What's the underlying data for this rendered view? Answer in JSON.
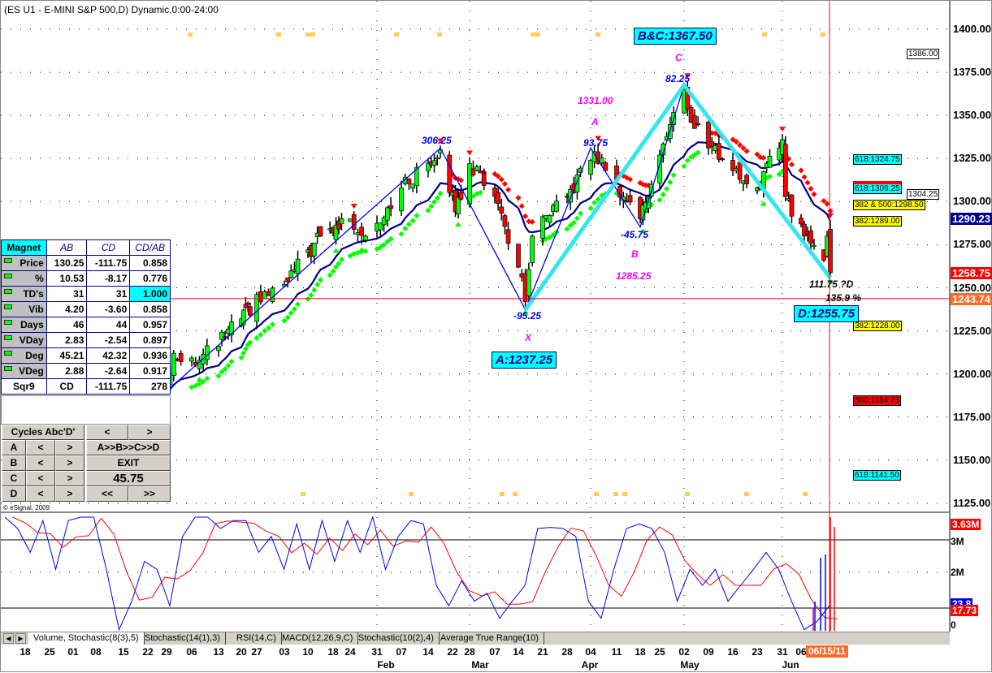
{
  "window": {
    "title": "(ES U1 - E-MINI S&P 500,D) Dynamic,0:00-24:00",
    "copyright": "© eSignal, 2009"
  },
  "colors": {
    "cyan": "#00ffff",
    "navy": "#00008b",
    "magenta": "#ff00ff",
    "red": "#ff0000",
    "green": "#00cc00",
    "orange": "#ff6a2a",
    "yellow": "#ffff00"
  },
  "price_axis": {
    "labels": [
      "1400.00",
      "1375.00",
      "1350.00",
      "1325.00",
      "1300.00",
      "1275.00",
      "1250.00",
      "1225.00",
      "1200.00",
      "1175.00",
      "1150.00",
      "1125.00"
    ],
    "highlights": [
      {
        "value": "1290.23",
        "price": 1290.23,
        "color": "#00008b"
      },
      {
        "value": "1258.75",
        "price": 1258.75,
        "color": "#ff0000"
      },
      {
        "value": "1243.74",
        "price": 1243.74,
        "color": "#ff6a2a"
      }
    ],
    "boxes": [
      {
        "text": "1386.00",
        "price": 1386
      },
      {
        "text": "1304.25",
        "price": 1304.25
      }
    ]
  },
  "fib_levels": [
    {
      "text": "618:1324.75",
      "price": 1324.75,
      "color": "#00ffff"
    },
    {
      "text": "618:1309.25",
      "price": 1309.25,
      "color": "#00ffff"
    },
    {
      "text": "382 & 500:1298.50",
      "price": 1298.5,
      "color": "#ffff00"
    },
    {
      "text": "382:1289.00",
      "price": 1289,
      "color": "#ffff00"
    },
    {
      "text": "382:1228.00",
      "price": 1228,
      "color": "#ffff00"
    },
    {
      "text": "500:1184.75",
      "price": 1184.75,
      "color": "#ff0000"
    },
    {
      "text": "618:1141.50",
      "price": 1141.5,
      "color": "#00ffff"
    }
  ],
  "pattern": {
    "boxes": {
      "bc": "B&C:1367.50",
      "a": "A:1237.25",
      "d": "D:1255.75"
    },
    "labels": {
      "p1": "306.25",
      "x_val": "-95.25",
      "a_val": "93.75",
      "b_val": "-45.75",
      "c_val": "82.25",
      "d_val": "111.75 ?D",
      "d_pct": "135.9 %",
      "a_price": "1331.00",
      "a_letter": "A",
      "b_price": "1285.25",
      "b_letter": "B",
      "c_letter": "C",
      "x_letter": "X"
    },
    "blue_points": [
      [
        "2010-11-29",
        1190
      ],
      [
        "2011-02-18",
        1331
      ],
      [
        "2011-03-16",
        1237.25
      ],
      [
        "2011-04-04",
        1331
      ],
      [
        "2011-04-18",
        1285.25
      ],
      [
        "2011-05-02",
        1367.5
      ]
    ],
    "cyan_points": [
      [
        "2011-03-16",
        1237.25
      ],
      [
        "2011-05-02",
        1367.5
      ],
      [
        "2011-06-15",
        1255.75
      ]
    ]
  },
  "magnet": {
    "headers": [
      "Magnet",
      "AB",
      "CD",
      "CD/AB"
    ],
    "rows": [
      [
        "Price",
        "130.25",
        "-111.75",
        "0.858"
      ],
      [
        "%",
        "10.53",
        "-8.17",
        "0.776"
      ],
      [
        "TD's",
        "31",
        "31",
        "1.000"
      ],
      [
        "Vib",
        "4.20",
        "-3.60",
        "0.858"
      ],
      [
        "Days",
        "46",
        "44",
        "0.957"
      ],
      [
        "VDay",
        "2.83",
        "-2.54",
        "0.897"
      ],
      [
        "Deg",
        "45.21",
        "42.32",
        "0.936"
      ],
      [
        "VDeg",
        "2.88",
        "-2.64",
        "0.917"
      ]
    ],
    "sqr9": [
      "Sqr9",
      "CD",
      "-111.75",
      "278"
    ]
  },
  "cycles": {
    "title": "Cycles Abc'D'",
    "left": "<",
    "right": ">",
    "rows": [
      "A",
      "B",
      "C",
      "D"
    ],
    "sequence": "A>>B>>C>>D",
    "exit": "EXIT",
    "value": "45.75",
    "prev": "<<",
    "next": ">>"
  },
  "lower_axis": {
    "labels": [
      "3M",
      "2M",
      "0"
    ],
    "vol_last": "3.63M",
    "stoch_blue": "23.8",
    "stoch_red": "17.73"
  },
  "tabs": [
    "Volume, Stochastic(8(3),5)",
    "Stochastic(14(1),3)",
    "RSI(14,C)",
    "MACD(12,26,9,C)",
    "Stochastic(10(2),4)",
    "Average True Range(10)"
  ],
  "date_axis": {
    "days": [
      "18",
      "25",
      "01",
      "08",
      "15",
      "22",
      "29",
      "06",
      "13",
      "20",
      "27",
      "03",
      "10",
      "18",
      "24",
      "31",
      "07",
      "14",
      "22",
      "28",
      "07",
      "14",
      "21",
      "28",
      "04",
      "11",
      "18",
      "25",
      "02",
      "09",
      "16",
      "23",
      "31",
      "06"
    ],
    "months": [
      "Feb",
      "Mar",
      "Apr",
      "May",
      "Jun"
    ],
    "current": "06/15/11"
  },
  "chart_data": {
    "type": "candlestick",
    "title": "(ES U1 - E-MINI S&P 500,D)",
    "ylim": [
      1125,
      1400
    ],
    "price_path": [
      [
        "2010-11-29",
        1190
      ],
      [
        "2010-12-01",
        1212
      ],
      [
        "2010-12-08",
        1208
      ],
      [
        "2010-12-20",
        1232
      ],
      [
        "2011-01-03",
        1252
      ],
      [
        "2011-01-14",
        1280
      ],
      [
        "2011-01-24",
        1290
      ],
      [
        "2011-01-28",
        1280
      ],
      [
        "2011-02-07",
        1308
      ],
      [
        "2011-02-18",
        1330
      ],
      [
        "2011-02-23",
        1294
      ],
      [
        "2011-02-28",
        1322
      ],
      [
        "2011-03-07",
        1303
      ],
      [
        "2011-03-14",
        1262
      ],
      [
        "2011-03-16",
        1242
      ],
      [
        "2011-03-18",
        1280
      ],
      [
        "2011-03-28",
        1303
      ],
      [
        "2011-04-05",
        1329
      ],
      [
        "2011-04-08",
        1318
      ],
      [
        "2011-04-18",
        1290
      ],
      [
        "2011-04-25",
        1327
      ],
      [
        "2011-05-02",
        1365
      ],
      [
        "2011-05-04",
        1346
      ],
      [
        "2011-05-10",
        1332
      ],
      [
        "2011-05-16",
        1318
      ],
      [
        "2011-05-23",
        1308
      ],
      [
        "2011-05-31",
        1336
      ],
      [
        "2011-06-01",
        1303
      ],
      [
        "2011-06-07",
        1280
      ],
      [
        "2011-06-13",
        1266
      ],
      [
        "2011-06-14",
        1280
      ],
      [
        "2011-06-15",
        1258.75
      ]
    ],
    "last_price": 1258.75,
    "ma": 1290.23,
    "current_line": 1243.74,
    "stoch_k": [
      100,
      90,
      69,
      97,
      54,
      97,
      100,
      100,
      54,
      1,
      26,
      61,
      54,
      22,
      83,
      100,
      100,
      90,
      97,
      97,
      69,
      83,
      54,
      94,
      54,
      97,
      61,
      97,
      69,
      100,
      54,
      83,
      97,
      94,
      40,
      22,
      44,
      26,
      33,
      11,
      26,
      40,
      90,
      91,
      90,
      83,
      26,
      11,
      54,
      90,
      94,
      90,
      69,
      26,
      54,
      40,
      54,
      26,
      40,
      54,
      69,
      54,
      26,
      1,
      8,
      22
    ]
  }
}
